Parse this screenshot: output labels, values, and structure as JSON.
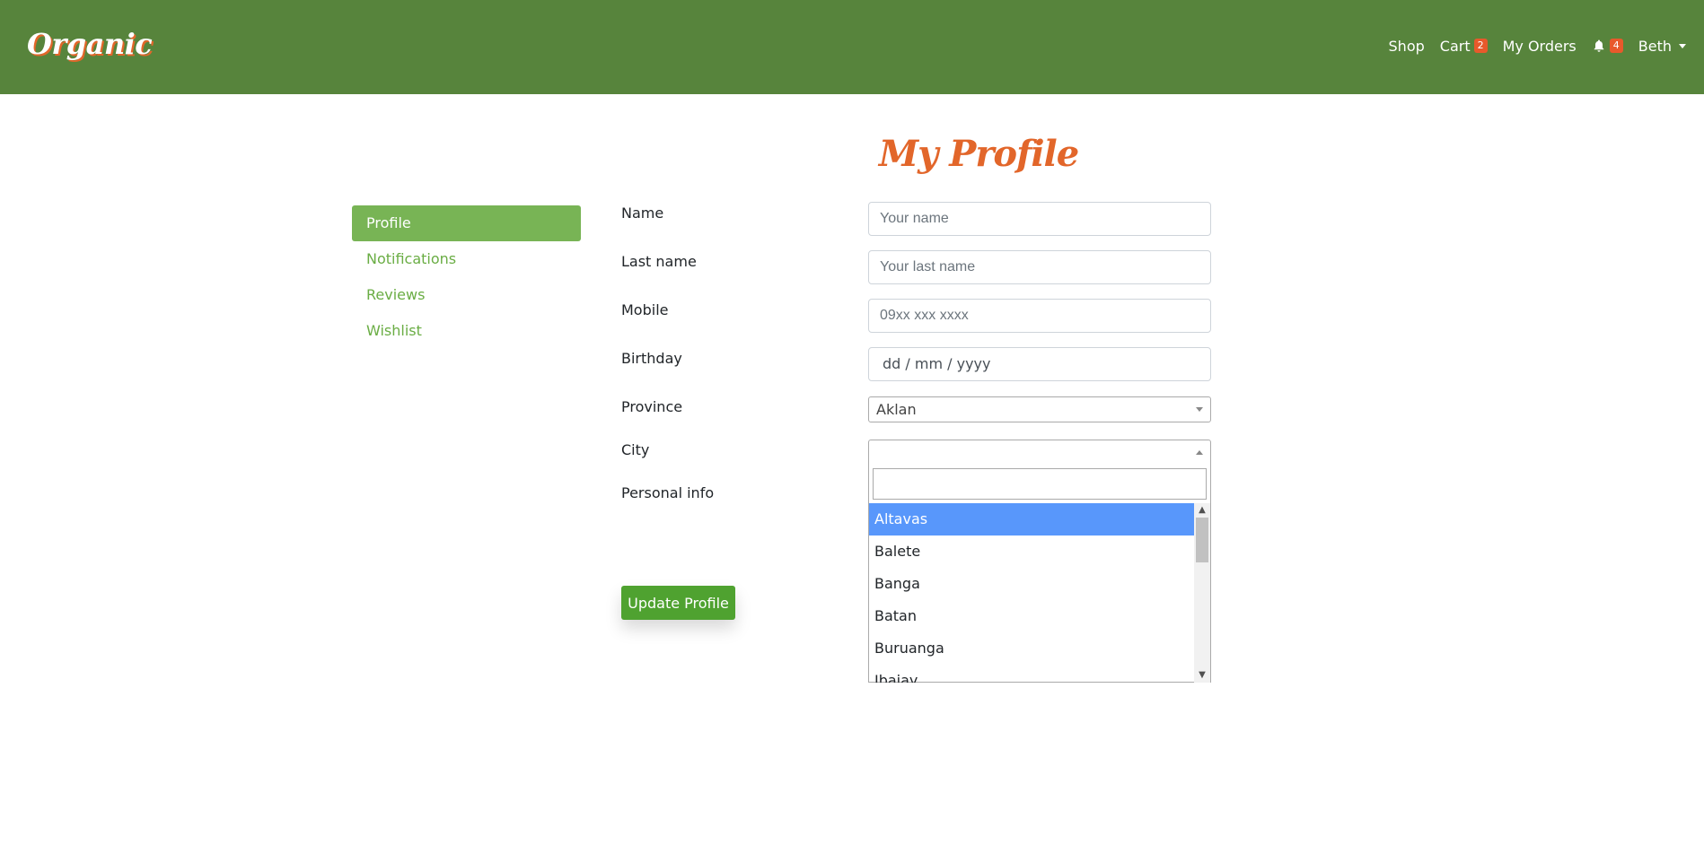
{
  "header": {
    "brand": "Organic",
    "nav": {
      "shop": "Shop",
      "cart": "Cart",
      "cart_count": "2",
      "orders": "My Orders",
      "notifications_count": "4",
      "user": "Beth"
    },
    "colors": {
      "bar": "#57843c",
      "badge": "#e8592b"
    }
  },
  "page_title": "My Profile",
  "sidebar": {
    "items": [
      {
        "label": "Profile",
        "active": true
      },
      {
        "label": "Notifications",
        "active": false
      },
      {
        "label": "Reviews",
        "active": false
      },
      {
        "label": "Wishlist",
        "active": false
      }
    ]
  },
  "form": {
    "name": {
      "label": "Name",
      "placeholder": "Your name",
      "value": ""
    },
    "last_name": {
      "label": "Last name",
      "placeholder": "Your last name",
      "value": ""
    },
    "mobile": {
      "label": "Mobile",
      "placeholder": "09xx xxx xxxx",
      "value": ""
    },
    "birthday": {
      "label": "Birthday",
      "display": "dd / mm / yyyy"
    },
    "province": {
      "label": "Province",
      "selected": "Aklan"
    },
    "city": {
      "label": "City",
      "selected": "",
      "search_value": "",
      "options": [
        "Altavas",
        "Balete",
        "Banga",
        "Batan",
        "Buruanga",
        "Ibajay"
      ],
      "highlighted": "Altavas"
    },
    "personal_info": {
      "label": "Personal info"
    },
    "submit_label": "Update Profile"
  }
}
